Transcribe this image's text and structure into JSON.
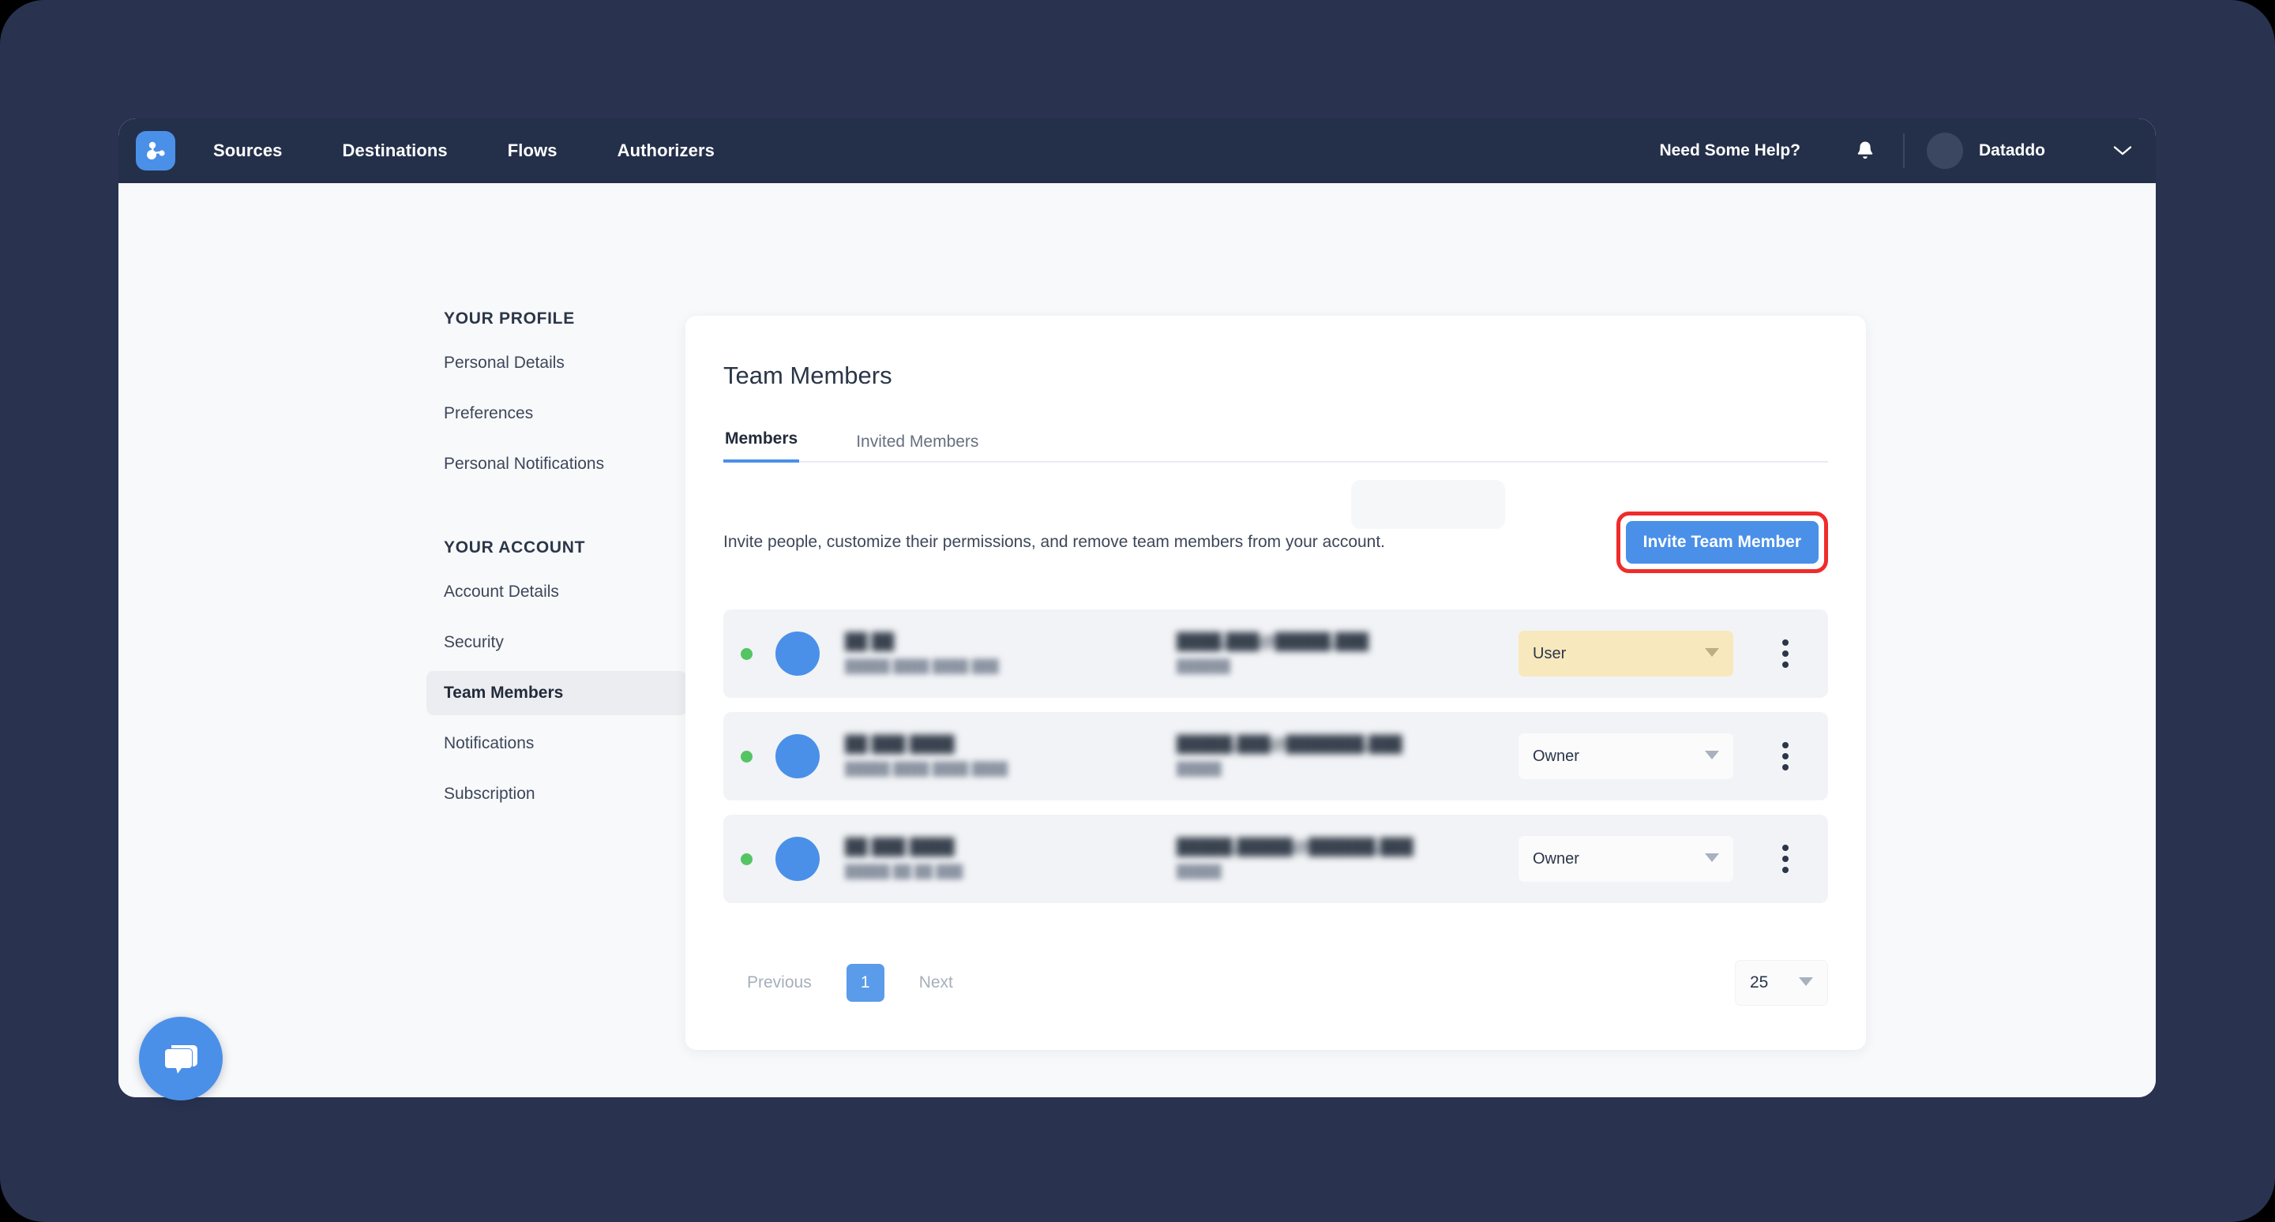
{
  "navbar": {
    "logo_name": "datoddo-logo",
    "links": [
      {
        "label": "Sources"
      },
      {
        "label": "Destinations"
      },
      {
        "label": "Flows"
      },
      {
        "label": "Authorizers"
      }
    ],
    "help_label": "Need Some Help?",
    "notifications_icon": "bell-icon",
    "account_name": "Dataddo",
    "account_caret_icon": "chevron-down-icon"
  },
  "settings_nav": {
    "profile_section_title": "YOUR PROFILE",
    "profile_items": [
      {
        "label": "Personal Details",
        "active": false
      },
      {
        "label": "Preferences",
        "active": false
      },
      {
        "label": "Personal Notifications",
        "active": false
      }
    ],
    "account_section_title": "YOUR ACCOUNT",
    "account_items": [
      {
        "label": "Account Details",
        "active": false
      },
      {
        "label": "Security",
        "active": false
      },
      {
        "label": "Team Members",
        "active": true
      },
      {
        "label": "Notifications",
        "active": false
      },
      {
        "label": "Subscription",
        "active": false
      }
    ]
  },
  "card": {
    "title": "Team Members",
    "tabs": [
      {
        "label": "Members",
        "active": true
      },
      {
        "label": "Invited Members",
        "active": false
      }
    ],
    "description": "Invite people, customize their permissions, and remove team members from your account.",
    "invite_button_label": "Invite Team Member",
    "invite_button_color": "#4a90e8",
    "invite_highlight_color": "#f02b2b"
  },
  "members": [
    {
      "status": "online",
      "name": "██ ██",
      "subtitle": "█████ ████ ████ ███",
      "email": "████.███@█████.███",
      "phone": "██████",
      "role": "User",
      "role_highlighted": true,
      "menu_icon": "kebab-menu-icon"
    },
    {
      "status": "online",
      "name": "██ ███ ████",
      "subtitle": "█████ ████ ████ ████",
      "email": "█████.███@███████.███",
      "phone": "█████",
      "role": "Owner",
      "role_highlighted": false,
      "menu_icon": "kebab-menu-icon"
    },
    {
      "status": "online",
      "name": "██ ███ ████",
      "subtitle": "█████ ██ ██ ███",
      "email": "█████.█████@██████.███",
      "phone": "█████",
      "role": "Owner",
      "role_highlighted": false,
      "menu_icon": "kebab-menu-icon"
    }
  ],
  "pagination": {
    "previous_label": "Previous",
    "current_page": "1",
    "next_label": "Next",
    "page_size": "25"
  },
  "chat_widget": {
    "icon": "chat-bubble-icon",
    "color": "#4a90e8"
  }
}
